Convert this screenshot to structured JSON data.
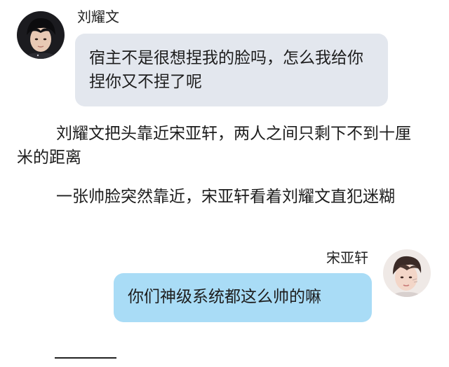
{
  "messages": [
    {
      "sender": "刘耀文",
      "avatar_icon": "boy-portrait-dark-hair",
      "side": "left",
      "text": "宿主不是很想捏我的脸吗，怎么我给你捏你又不捏了呢"
    },
    {
      "sender": "宋亚轩",
      "avatar_icon": "boy-portrait-light",
      "side": "right",
      "text": "你们神级系统都这么帅的嘛"
    }
  ],
  "narration": [
    "刘耀文把头靠近宋亚轩，两人之间只剩下不到十厘米的距离",
    "一张帅脸突然靠近，宋亚轩看着刘耀文直犯迷糊"
  ],
  "colors": {
    "left_bubble": "#e3e7ee",
    "right_bubble": "#a9dcf6"
  }
}
